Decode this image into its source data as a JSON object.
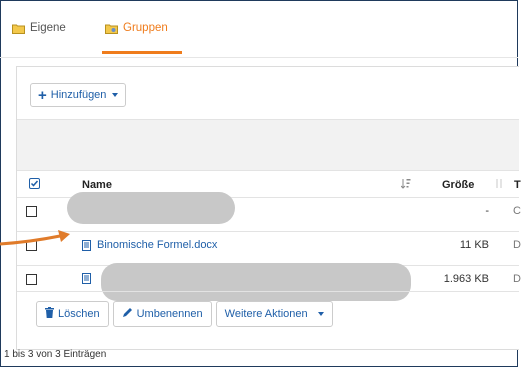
{
  "tabs": {
    "own_label": "Eigene",
    "groups_label": "Gruppen"
  },
  "toolbar": {
    "add_label": "Hinzufügen"
  },
  "table": {
    "headers": {
      "name": "Name",
      "size": "Größe",
      "type_partial": "T"
    },
    "rows": [
      {
        "name": "",
        "size": "-",
        "type_partial": "C",
        "redacted": true
      },
      {
        "name": "Binomische Formel.docx",
        "size": "11 KB",
        "type_partial": "D",
        "redacted": false
      },
      {
        "name": "",
        "size": "1.963 KB",
        "type_partial": "D",
        "redacted": true
      }
    ]
  },
  "actions": {
    "delete_label": "Löschen",
    "rename_label": "Umbenennen",
    "more_label": "Weitere Aktionen"
  },
  "footer": {
    "info": "1 bis 3 von 3 Einträgen"
  },
  "colors": {
    "accent": "#ef7c1c",
    "link": "#1f5fa8",
    "arrow": "#e07b2a"
  },
  "icons": [
    "folder-icon",
    "folder-group-icon",
    "plus-icon",
    "checkbox-icon",
    "sort-icon",
    "document-icon",
    "trash-icon",
    "pencil-icon",
    "arrow-icon"
  ]
}
